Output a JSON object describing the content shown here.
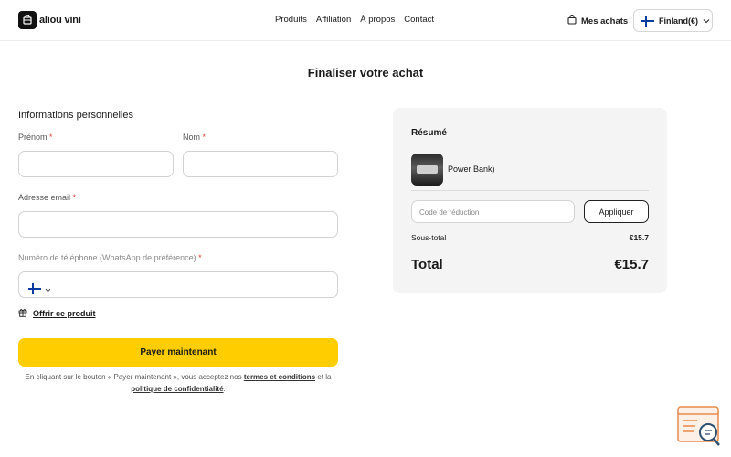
{
  "header": {
    "brand": "aliou vini",
    "nav": [
      "Produits",
      "Affiliation",
      "À propos",
      "Contact"
    ],
    "orders_label": "Mes achats",
    "country_label": "Finland(€)"
  },
  "page": {
    "title": "Finaliser votre achat"
  },
  "form": {
    "section_title": "Informations personnelles",
    "first_name_label": "Prénom",
    "last_name_label": "Nom",
    "email_label": "Adresse email",
    "phone_label": "Numéro de téléphone (WhatsApp de préférence)",
    "required_mark": "*",
    "gift_label": "Offrir ce produit",
    "pay_label": "Payer maintenant",
    "terms_prefix": "En cliquant sur le bouton « Payer maintenant », vous acceptez nos",
    "terms_link": "termes et conditions",
    "terms_mid": "et la",
    "privacy_link": "politique de confidentialité",
    "terms_suffix": "."
  },
  "summary": {
    "title": "Résumé",
    "product_name": "Power Bank)",
    "promo_placeholder": "Code de réduction",
    "apply_label": "Appliquer",
    "subtotal_label": "Sous-total",
    "subtotal_value": "€15.7",
    "total_label": "Total",
    "total_value": "€15.7"
  },
  "colors": {
    "accent": "#ffcd00",
    "summary_bg": "#f4f4f4",
    "required": "#e0403a"
  }
}
